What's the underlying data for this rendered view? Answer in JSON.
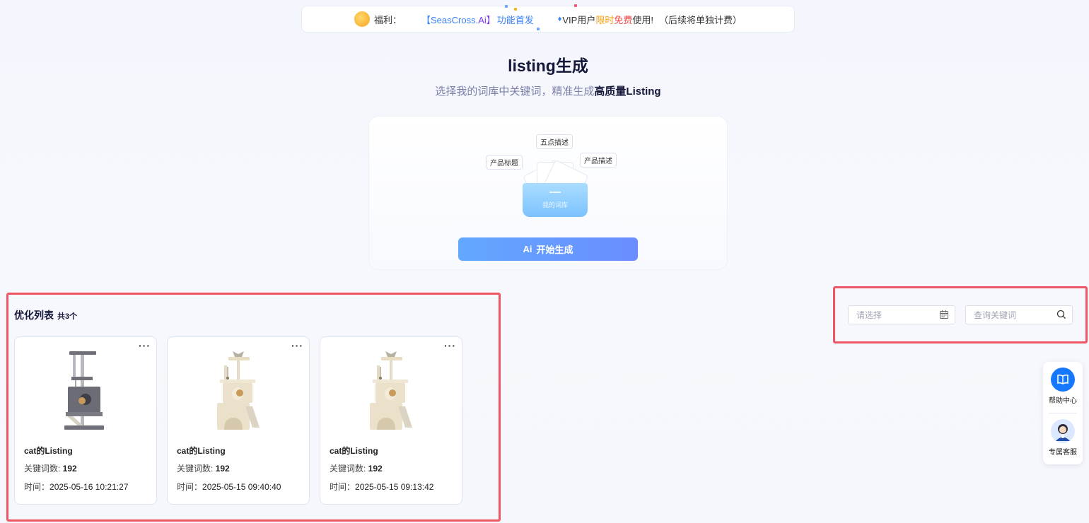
{
  "banner": {
    "prefix": "福利：",
    "brand_open": "【SeasCross.",
    "brand_ai": "Ai】",
    "feature": "功能首发",
    "vip_star": "♦",
    "vip_text": "VIP用户",
    "limited": "限时",
    "free": "免费",
    "use": "使用!",
    "note": "（后续将单独计费）"
  },
  "header": {
    "title": "listing生成",
    "subtitle_normal": "选择我的词库中关键词，精准生成",
    "subtitle_bold": "高质量Listing"
  },
  "hero": {
    "tags": [
      "五点描述",
      "产品标题",
      "产品描述"
    ],
    "folder_label": "我的词库",
    "generate_button": "开始生成",
    "generate_icon_text": "Ai"
  },
  "list": {
    "title": "优化列表",
    "count": "共3个",
    "kw_label": "关键词数: ",
    "time_label": "时间：",
    "items": [
      {
        "name": "cat的Listing",
        "keywords": "192",
        "time": "2025-05-16 10:21:27",
        "more": "···",
        "variant": "gray"
      },
      {
        "name": "cat的Listing",
        "keywords": "192",
        "time": "2025-05-15 09:40:40",
        "more": "···",
        "variant": "beige"
      },
      {
        "name": "cat的Listing",
        "keywords": "192",
        "time": "2025-05-15 09:13:42",
        "more": "···",
        "variant": "beige"
      }
    ]
  },
  "filters": {
    "date_placeholder": "请选择",
    "keyword_placeholder": "查询关键词"
  },
  "float_menu": {
    "help": "帮助中心",
    "service": "专属客服"
  },
  "colors": {
    "accent": "#5b9bff",
    "highlight_frame": "#ee5565",
    "limited": "#f59e0b",
    "free": "#ef4444"
  }
}
